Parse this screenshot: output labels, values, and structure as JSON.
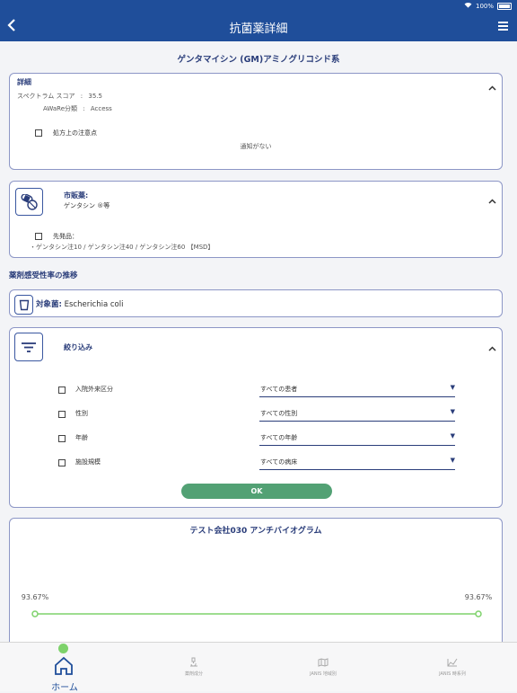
{
  "status_bar": {
    "battery_text": "100%"
  },
  "nav": {
    "title": "抗菌薬詳細"
  },
  "drug": {
    "title": "ゲンタマイシン (GM)アミノグリコシド系"
  },
  "details": {
    "heading": "詳細",
    "spectrum_label": "スペクトラム スコア",
    "spectrum_value": "35.5",
    "aware_label": "AWaRe分類",
    "aware_value": "Access",
    "separator": ":",
    "caution_label": "処方上の注意点",
    "notice_text": "通知がない"
  },
  "market": {
    "heading": "市販薬:",
    "name": "ゲンタシン ®等",
    "original_label": "先発品：",
    "original_list": "・ゲンタシン注10 / ゲンタシン注40 / ゲンタシン注60 【MSD】"
  },
  "susceptibility": {
    "section_title": "薬剤感受性率の推移",
    "target_label": "対象菌:",
    "target_value": "Escherichia coli"
  },
  "filter": {
    "heading": "絞り込み",
    "rows": [
      {
        "label": "入院外来区分",
        "value": "すべての患者"
      },
      {
        "label": "性別",
        "value": "すべての性別"
      },
      {
        "label": "年齢",
        "value": "すべての年齢"
      },
      {
        "label": "施設規模",
        "value": "すべての病床"
      }
    ],
    "ok_label": "OK"
  },
  "chart_data": {
    "type": "line",
    "title": "テスト会社030 アンチバイオグラム",
    "x": [
      0,
      1
    ],
    "series": [
      {
        "values": [
          93.67,
          93.67
        ]
      }
    ],
    "data_labels": [
      "93.67%",
      "93.67%"
    ],
    "color": "#7ed26b"
  },
  "tabbar": {
    "items": [
      {
        "label": "ホーム",
        "icon": "home-icon",
        "active": true
      },
      {
        "label": "薬剤成分",
        "icon": "microscope-icon",
        "active": false
      },
      {
        "label": "JANIS 地域別",
        "icon": "map-icon",
        "active": false
      },
      {
        "label": "JANIS 時系列",
        "icon": "chart-icon",
        "active": false
      }
    ]
  },
  "colors": {
    "primary": "#1f4e9a",
    "ok_button": "#52a174",
    "active_dot": "#7ed26b"
  }
}
